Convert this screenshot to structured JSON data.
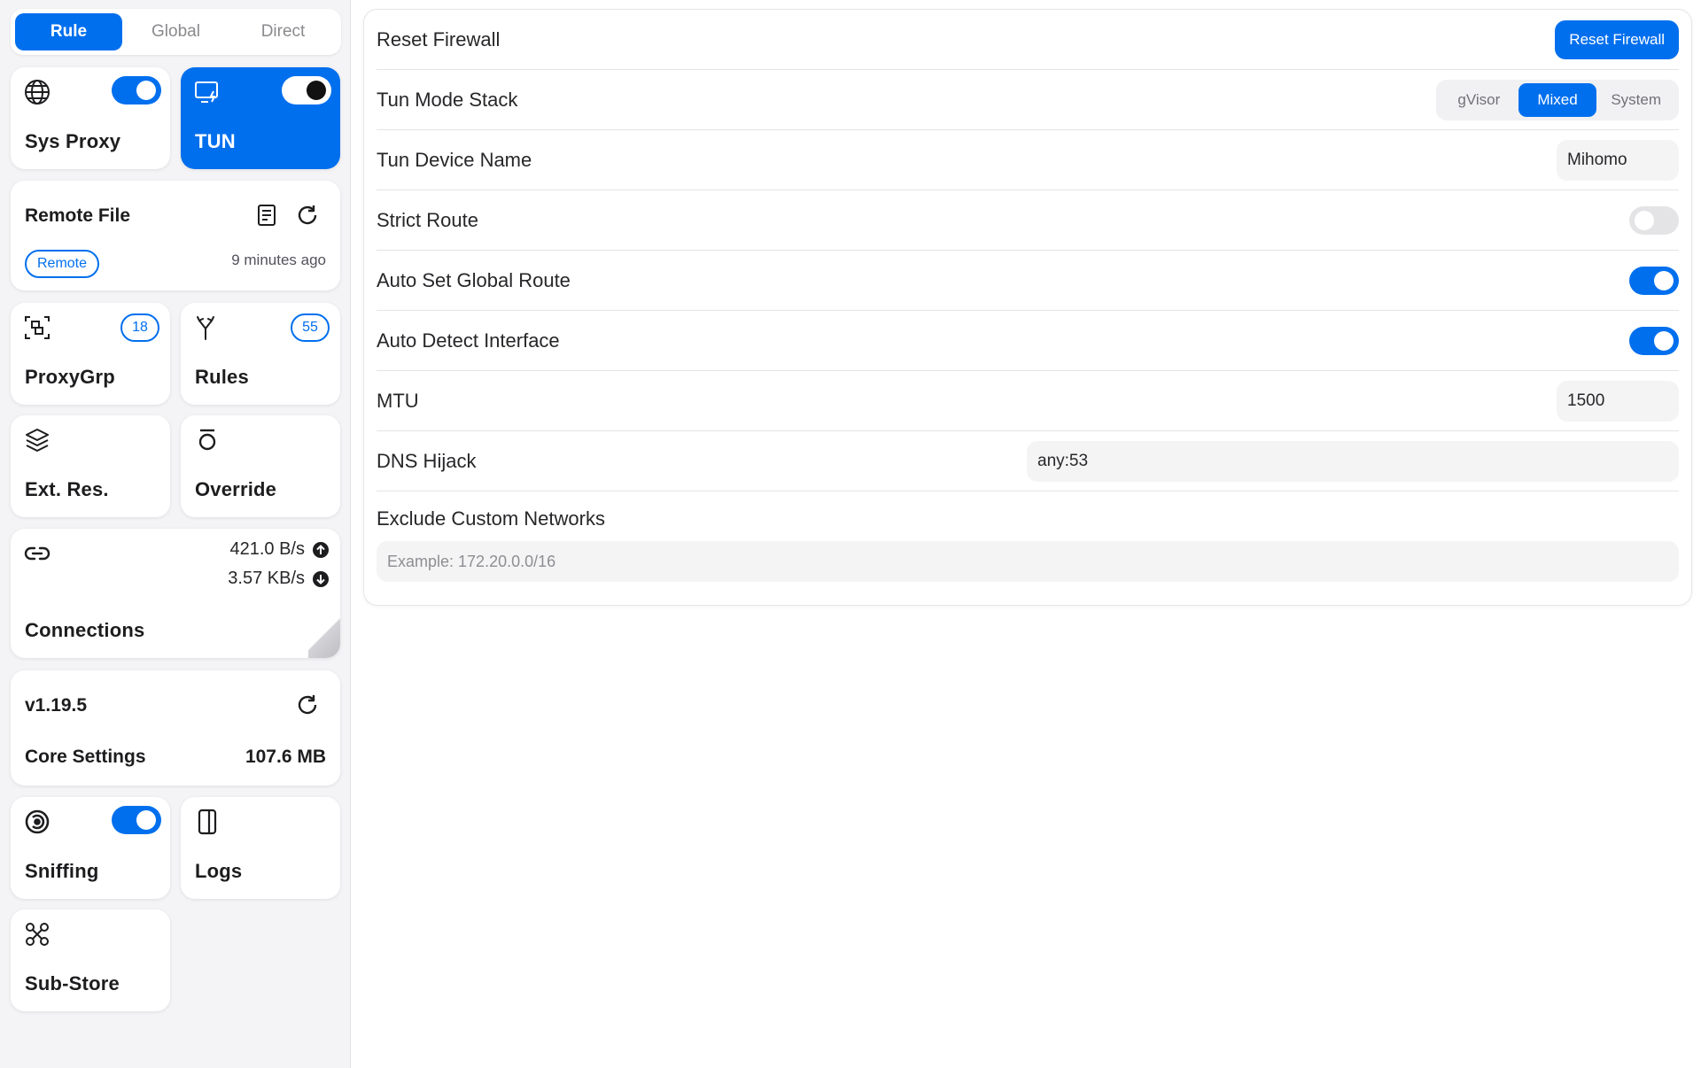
{
  "mode_tabs": [
    {
      "label": "Rule",
      "active": true
    },
    {
      "label": "Global",
      "active": false
    },
    {
      "label": "Direct",
      "active": false
    }
  ],
  "cards": {
    "sys_proxy": {
      "title": "Sys Proxy",
      "icon": "globe-icon",
      "enabled": true
    },
    "tun": {
      "title": "TUN",
      "icon": "monitor-lightning-icon",
      "enabled": true,
      "active": true
    },
    "remote_file": {
      "title": "Remote File",
      "chip": "Remote",
      "updated": "9 minutes ago",
      "icons": [
        "document-icon",
        "refresh-icon"
      ]
    },
    "proxy_grp": {
      "title": "ProxyGrp",
      "icon": "group-icon",
      "count": "18"
    },
    "rules": {
      "title": "Rules",
      "icon": "branch-icon",
      "count": "55"
    },
    "ext_res": {
      "title": "Ext. Res.",
      "icon": "layers-icon"
    },
    "override": {
      "title": "Override",
      "icon": "override-icon"
    },
    "connections": {
      "title": "Connections",
      "icon": "link-icon",
      "upload": "421.0 B/s",
      "download": "3.57 KB/s"
    },
    "core": {
      "version": "v1.19.5",
      "title": "Core Settings",
      "memory": "107.6 MB",
      "icon": "refresh-icon"
    },
    "sniffing": {
      "title": "Sniffing",
      "icon": "sniff-icon",
      "enabled": true
    },
    "logs": {
      "title": "Logs",
      "icon": "panel-icon"
    },
    "sub_store": {
      "title": "Sub-Store",
      "icon": "substore-icon"
    }
  },
  "settings": {
    "reset_firewall": {
      "label": "Reset Firewall",
      "button": "Reset Firewall"
    },
    "tun_stack": {
      "label": "Tun Mode Stack",
      "options": [
        "gVisor",
        "Mixed",
        "System"
      ],
      "selected": "Mixed"
    },
    "device_name": {
      "label": "Tun Device Name",
      "value": "Mihomo"
    },
    "strict_route": {
      "label": "Strict Route",
      "enabled": false
    },
    "auto_route": {
      "label": "Auto Set Global Route",
      "enabled": true
    },
    "auto_detect": {
      "label": "Auto Detect Interface",
      "enabled": true
    },
    "mtu": {
      "label": "MTU",
      "value": "1500"
    },
    "dns_hijack": {
      "label": "DNS Hijack",
      "value": "any:53"
    },
    "exclude": {
      "label": "Exclude Custom Networks",
      "placeholder": "Example: 172.20.0.0/16"
    }
  },
  "colors": {
    "accent": "#006fee",
    "sidebar_bg": "#f4f4f6",
    "card_bg": "#ffffff"
  }
}
